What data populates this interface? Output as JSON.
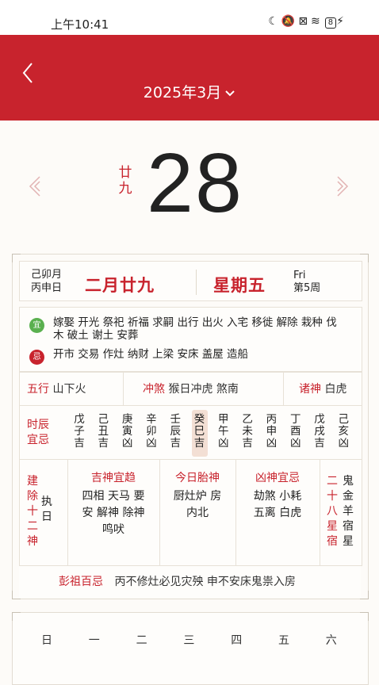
{
  "status": {
    "time": "上午10:41",
    "battery": "8"
  },
  "header": {
    "month": "2025年3月"
  },
  "day": {
    "number": "28",
    "lunar_day": [
      "廿",
      "九"
    ]
  },
  "date_row": {
    "month_ganzhi": "己卯月",
    "day_ganzhi": "丙申日",
    "lunar": "二月廿九",
    "weekday": "星期五",
    "weekday_en": "Fri",
    "week_no": "第5周"
  },
  "yiji": {
    "yi_badge": "宜",
    "yi_items": "嫁娶 开光 祭祀 祈福 求嗣 出行 出火 入宅 移徙 解除 栽种 伐木 破土 谢土 安葬",
    "ji_badge": "忌",
    "ji_items": "开市 交易 作灶 纳财 上梁 安床 盖屋 造船"
  },
  "info": {
    "wuxing_label": "五行",
    "wuxing_value": "山下火",
    "chongsha_label": "冲煞",
    "chongsha_value": "猴日冲虎 煞南",
    "zhushen_label": "诸神",
    "zhushen_value": "白虎"
  },
  "hours": {
    "label": [
      "时辰",
      "宜忌"
    ],
    "cols": [
      {
        "g": "戊",
        "z": "子",
        "j": "吉"
      },
      {
        "g": "己",
        "z": "丑",
        "j": "吉"
      },
      {
        "g": "庚",
        "z": "寅",
        "j": "凶"
      },
      {
        "g": "辛",
        "z": "卯",
        "j": "凶"
      },
      {
        "g": "壬",
        "z": "辰",
        "j": "吉"
      },
      {
        "g": "癸",
        "z": "巳",
        "j": "吉"
      },
      {
        "g": "甲",
        "z": "午",
        "j": "凶"
      },
      {
        "g": "乙",
        "z": "未",
        "j": "吉"
      },
      {
        "g": "丙",
        "z": "申",
        "j": "凶"
      },
      {
        "g": "丁",
        "z": "酉",
        "j": "凶"
      },
      {
        "g": "戊",
        "z": "戌",
        "j": "吉"
      },
      {
        "g": "己",
        "z": "亥",
        "j": "凶"
      }
    ],
    "current_index": 5
  },
  "gods": {
    "jianchu_label": "建除十二神",
    "jianchu_value": "执日",
    "jishen_title": "吉神宜趋",
    "jishen_body": [
      "四相 天马 要",
      "安 解神 除神",
      "鸣吠"
    ],
    "taishen_title": "今日胎神",
    "taishen_body": [
      "厨灶炉 房",
      "内北"
    ],
    "xiongshen_title": "凶神宜忌",
    "xiongshen_body": [
      "劫煞 小耗",
      "五离 白虎"
    ],
    "xingxiu_label": "二十八星宿",
    "xingxiu_value": "鬼金羊宿星"
  },
  "pengzu": {
    "label": "彭祖百忌",
    "value": "丙不修灶必见灾殃 申不安床鬼祟入房"
  },
  "weekdays": [
    "日",
    "一",
    "二",
    "三",
    "四",
    "五",
    "六"
  ]
}
